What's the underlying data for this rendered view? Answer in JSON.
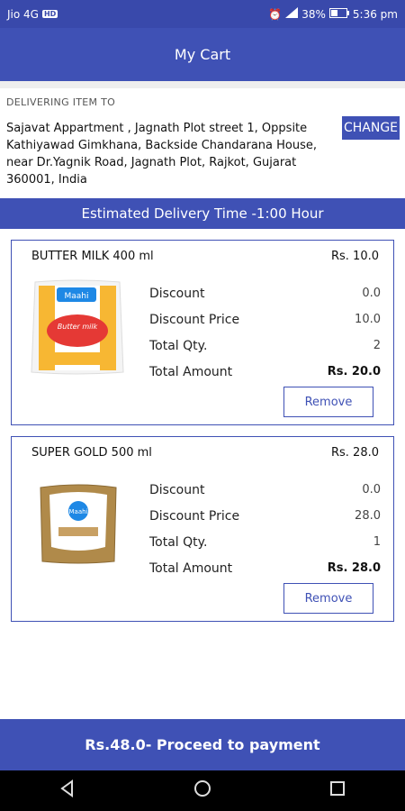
{
  "status": {
    "carrier": "Jio 4G",
    "badge": "HD",
    "battery": "38%",
    "time": "5:36 pm"
  },
  "appbar": {
    "title": "My Cart"
  },
  "delivery": {
    "label": "DELIVERING ITEM TO",
    "address": "Sajavat Appartment , Jagnath Plot street 1, Oppsite Kathiyawad Gimkhana, Backside Chandarana House, near Dr.Yagnik Road, Jagnath Plot, Rajkot, Gujarat 360001, India",
    "change_label": "CHANGE"
  },
  "estimate": {
    "text": "Estimated Delivery Time -1:00 Hour"
  },
  "items": [
    {
      "name": "BUTTER MILK 400 ml",
      "price": "Rs. 10.0",
      "discount_label": "Discount",
      "discount": "0.0",
      "discount_price_label": "Discount Price",
      "discount_price": "10.0",
      "qty_label": "Total Qty.",
      "qty": "2",
      "amount_label": "Total Amount",
      "amount": "Rs. 20.0",
      "remove_label": "Remove",
      "pack_brand": "Maahi",
      "pack_text": "Butter milk",
      "pack_accent": "#e53935"
    },
    {
      "name": "SUPER GOLD 500 ml",
      "price": "Rs. 28.0",
      "discount_label": "Discount",
      "discount": "0.0",
      "discount_price_label": "Discount Price",
      "discount_price": "28.0",
      "qty_label": "Total Qty.",
      "qty": "1",
      "amount_label": "Total Amount",
      "amount": "Rs. 28.0",
      "remove_label": "Remove",
      "pack_brand": "Maahi",
      "pack_accent": "#a07a3c"
    }
  ],
  "footer": {
    "proceed_label": "Rs.48.0- Proceed to payment"
  },
  "navbar": {
    "back_icon": "back-icon",
    "home_icon": "home-icon",
    "recents_icon": "recents-icon"
  },
  "colors": {
    "primary": "#3f51b5",
    "status_bar": "#3949ab"
  }
}
